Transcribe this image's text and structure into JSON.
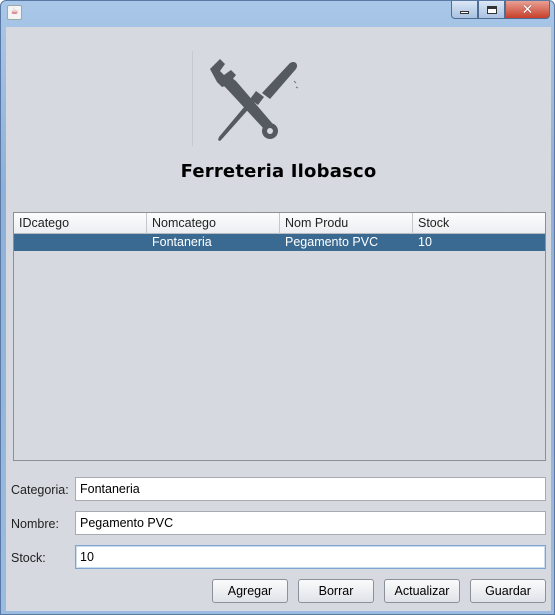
{
  "window": {
    "close_glyph": "✕",
    "icons": {
      "app": "java-cup-icon",
      "minimize": "minimize-icon",
      "maximize": "maximize-icon",
      "close": "close-icon"
    }
  },
  "header": {
    "logo_icon": "wrench-screwdriver-icon",
    "title": "Ferreteria Ilobasco"
  },
  "table": {
    "columns": [
      "IDcatego",
      "Nomcatego",
      "Nom Produ",
      "Stock"
    ],
    "rows": [
      {
        "selected": true,
        "cells": [
          "",
          "Fontaneria",
          "Pegamento PVC",
          "10"
        ]
      }
    ],
    "selection_color": "#3a6a92"
  },
  "form": {
    "categoria_label": "Categoria:",
    "categoria_value": "Fontaneria",
    "nombre_label": "Nombre:",
    "nombre_value": "Pegamento PVC",
    "stock_label": "Stock:",
    "stock_value": "10"
  },
  "buttons": {
    "agregar": "Agregar",
    "borrar": "Borrar",
    "actualizar": "Actualizar",
    "guardar": "Guardar"
  },
  "colors": {
    "panel_bg": "#d6d9df",
    "title_bar": "#9bbbe0",
    "close_button": "#c7402b"
  }
}
